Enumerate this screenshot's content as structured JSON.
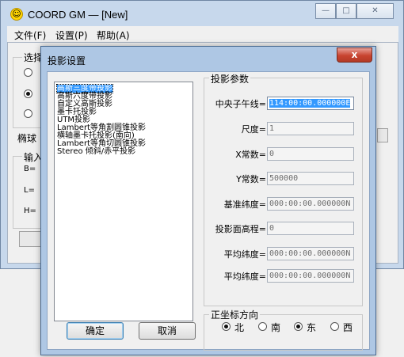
{
  "main_window": {
    "title": "COORD GM — [New]",
    "menu": [
      "文件(F)",
      "设置(P)",
      "帮助(A)"
    ],
    "partial_labels": {
      "select_group": "选择",
      "ellipsoid": "椭球",
      "input_group": "输入",
      "b": "B=",
      "l": "L=",
      "h": "H="
    }
  },
  "dialog": {
    "title": "投影设置",
    "close_glyph": "x",
    "projections": [
      "高斯三度带投影",
      "高斯六度带投影",
      "自定义高斯投影",
      "墨卡托投影",
      "UTM投影",
      "Lambert等角割圆锥投影",
      "横轴墨卡托投影(南向)",
      "Lambert等角切圆锥投影",
      "Stereo 倾斜/赤平投影"
    ],
    "selected_index": 0,
    "params_group": {
      "title": "投影参数",
      "fields": [
        {
          "label": "中央子午线=",
          "value": "114:00:00.000000E",
          "enabled": true
        },
        {
          "label": "尺度=",
          "value": "1",
          "enabled": false
        },
        {
          "label": "X常数=",
          "value": "0",
          "enabled": false
        },
        {
          "label": "Y常数=",
          "value": "500000",
          "enabled": false
        },
        {
          "label": "基准纬度=",
          "value": "000:00:00.000000N",
          "enabled": false
        },
        {
          "label": "投影面高程=",
          "value": "0",
          "enabled": false
        },
        {
          "label": "平均纬度=",
          "value": "000:00:00.000000N",
          "enabled": false
        },
        {
          "label": "平均纬度=",
          "value": "000:00:00.000000N",
          "enabled": false
        }
      ]
    },
    "direction_group": {
      "title": "正坐标方向",
      "options": [
        {
          "label": "北",
          "checked": true
        },
        {
          "label": "南",
          "checked": false
        },
        {
          "label": "东",
          "checked": true
        },
        {
          "label": "西",
          "checked": false
        }
      ]
    },
    "ok_label": "确定",
    "cancel_label": "取消"
  }
}
